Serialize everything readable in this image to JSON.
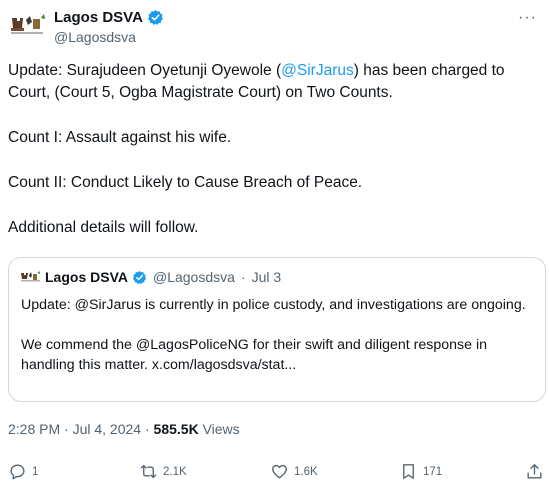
{
  "tweet": {
    "author_name": "Lagos DSVA",
    "author_handle": "@Lagosdsva",
    "more_label": "···",
    "text": {
      "update_prefix": "Update: Surajudeen Oyetunji Oyewole (",
      "mention": "@SirJarus",
      "update_suffix": ") has been charged to Court, (Court 5, Ogba Magistrate Court) on Two Counts.",
      "count1": "Count I: Assault against his wife.",
      "count2": "Count II: Conduct Likely to Cause Breach of Peace.",
      "closing": "Additional details will follow."
    },
    "quote": {
      "author_name": "Lagos DSVA",
      "author_handle": "@Lagosdsva",
      "separator": "·",
      "date": "Jul 3",
      "paragraph1": "Update: @SirJarus is currently in police custody, and investigations are ongoing.",
      "paragraph2": "We commend the @LagosPoliceNG for their swift and diligent response in handling this matter. x.com/lagosdsva/stat..."
    },
    "timestamp": "2:28 PM · Jul 4, 2024",
    "meta_sep": "·",
    "views_count": "585.5K",
    "views_label": "Views",
    "actions": {
      "replies": "1",
      "reposts": "2.1K",
      "likes": "1.6K",
      "bookmarks": "171"
    }
  },
  "colors": {
    "accent": "#1d9bf0",
    "muted": "#536471",
    "text": "#0f1419",
    "border": "#cfd9de"
  }
}
